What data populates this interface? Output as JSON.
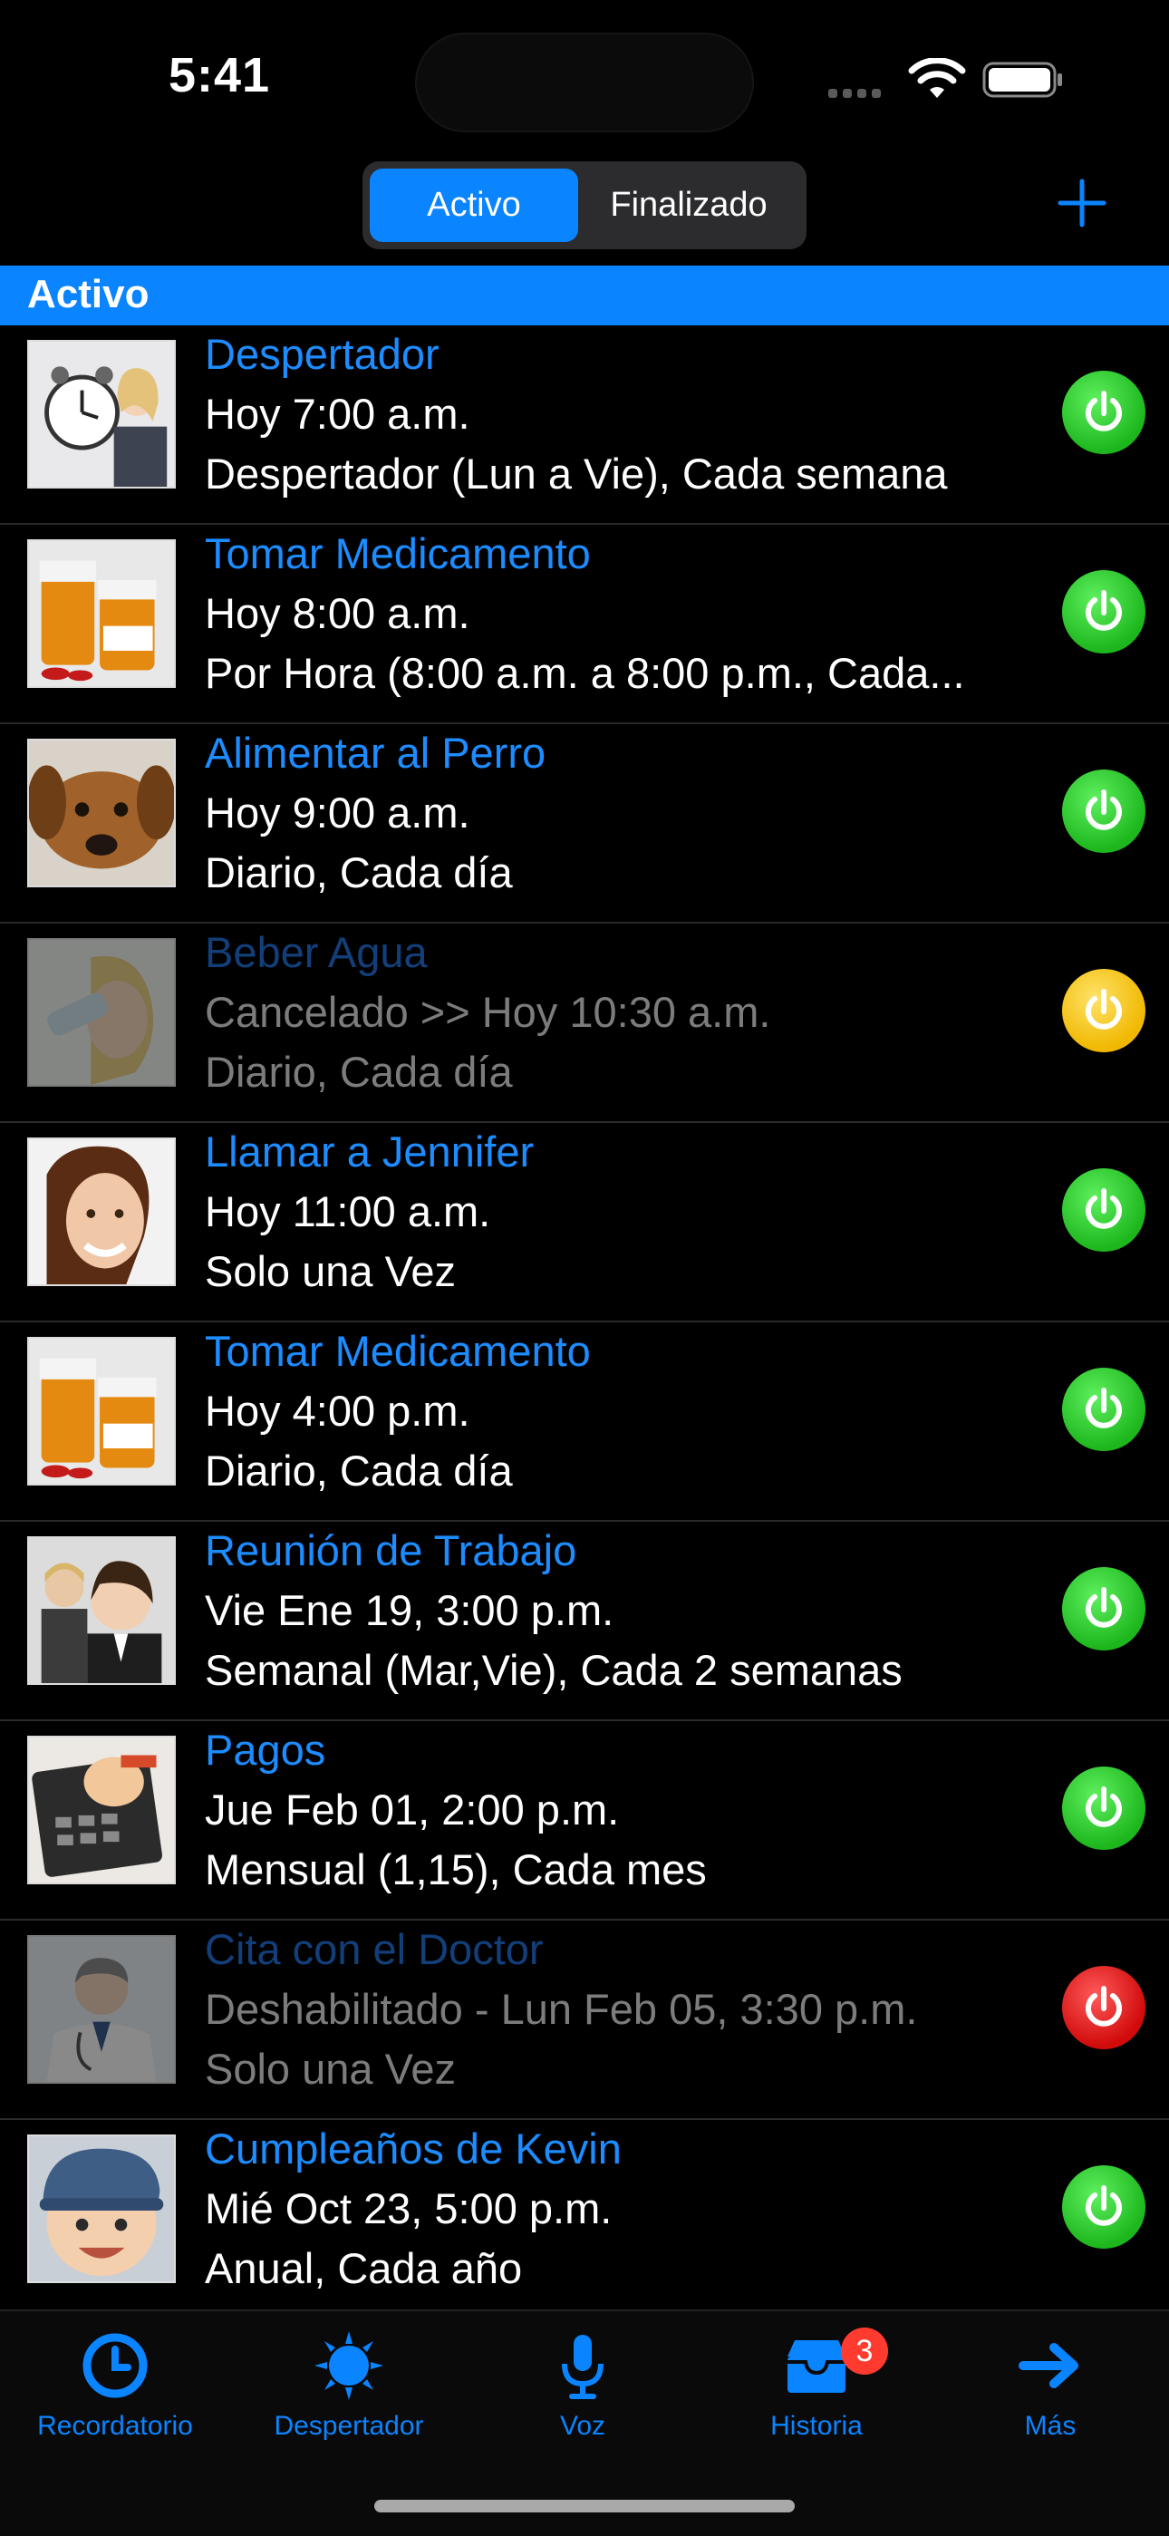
{
  "status_bar": {
    "time": "5:41"
  },
  "nav": {
    "segments": [
      "Activo",
      "Finalizado"
    ],
    "selected": "Activo"
  },
  "section": {
    "title": "Activo"
  },
  "colors": {
    "accent": "#0a84ff",
    "enabled": "#1db71d",
    "paused": "#f0b800",
    "disabled": "#d10a0a"
  },
  "reminders": [
    {
      "title": "Despertador",
      "when": "Hoy 7:00 a.m.",
      "repeat": "Despertador (Lun a Vie), Cada semana",
      "status": "on",
      "image": "alarm-clock-woman"
    },
    {
      "title": "Tomar Medicamento",
      "when": "Hoy 8:00 a.m.",
      "repeat": "Por Hora (8:00 a.m. a 8:00 p.m., Cada...",
      "status": "on",
      "image": "pill-bottles"
    },
    {
      "title": "Alimentar al Perro",
      "when": "Hoy 9:00 a.m.",
      "repeat": "Diario, Cada día",
      "status": "on",
      "image": "dog"
    },
    {
      "title": "Beber Agua",
      "when": "Cancelado >> Hoy 10:30 a.m.",
      "repeat": "Diario, Cada día",
      "status": "paused",
      "image": "woman-drinking"
    },
    {
      "title": "Llamar a Jennifer",
      "when": "Hoy 11:00 a.m.",
      "repeat": "Solo una Vez",
      "status": "on",
      "image": "woman-smiling"
    },
    {
      "title": "Tomar Medicamento",
      "when": "Hoy 4:00 p.m.",
      "repeat": "Diario, Cada día",
      "status": "on",
      "image": "pill-bottles"
    },
    {
      "title": "Reunión de Trabajo",
      "when": "Vie Ene 19, 3:00 p.m.",
      "repeat": "Semanal (Mar,Vie), Cada 2 semanas",
      "status": "on",
      "image": "business-people"
    },
    {
      "title": "Pagos",
      "when": "Jue Feb 01, 2:00 p.m.",
      "repeat": "Mensual (1,15), Cada mes",
      "status": "on",
      "image": "piggy-bank-calculator"
    },
    {
      "title": "Cita con el Doctor",
      "when": "Deshabilitado - Lun Feb 05, 3:30 p.m.",
      "repeat": "Solo una Vez",
      "status": "off",
      "image": "doctor"
    },
    {
      "title": "Cumpleaños de Kevin",
      "when": "Mié Oct 23, 5:00 p.m.",
      "repeat": "Anual, Cada año",
      "status": "on",
      "image": "baby"
    }
  ],
  "tabs": [
    {
      "label": "Recordatorio",
      "icon": "clock-icon"
    },
    {
      "label": "Despertador",
      "icon": "sun-icon"
    },
    {
      "label": "Voz",
      "icon": "microphone-icon"
    },
    {
      "label": "Historia",
      "icon": "inbox-icon",
      "badge": "3"
    },
    {
      "label": "Más",
      "icon": "arrow-right-icon"
    }
  ]
}
